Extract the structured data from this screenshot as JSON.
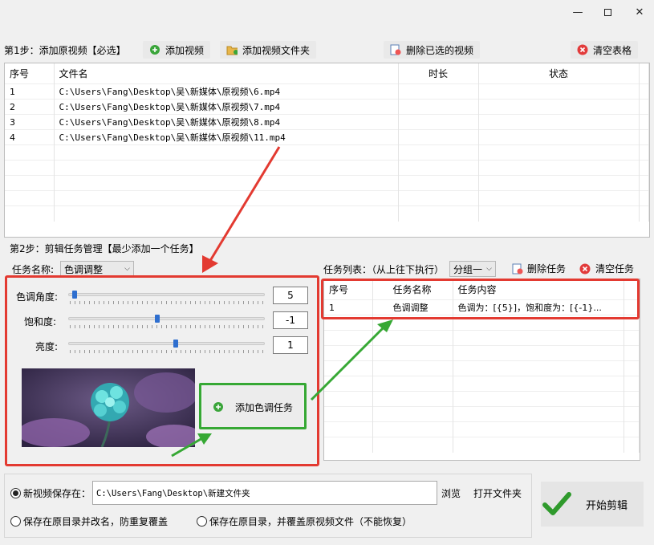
{
  "window": {
    "minimize_icon": "minimize-icon",
    "maximize_icon": "maximize-icon",
    "close_icon": "close-icon"
  },
  "step1": {
    "label": "第1步：添加原视频【必选】",
    "buttons": {
      "add_video": "添加视频",
      "add_folder": "添加视频文件夹",
      "delete_selected": "删除已选的视频",
      "clear_table": "清空表格"
    },
    "columns": [
      "序号",
      "文件名",
      "时长",
      "状态"
    ],
    "rows": [
      {
        "index": "1",
        "file": "C:\\Users\\Fang\\Desktop\\吴\\新媒体\\原视频\\6.mp4",
        "duration": "",
        "status": ""
      },
      {
        "index": "2",
        "file": "C:\\Users\\Fang\\Desktop\\吴\\新媒体\\原视频\\7.mp4",
        "duration": "",
        "status": ""
      },
      {
        "index": "3",
        "file": "C:\\Users\\Fang\\Desktop\\吴\\新媒体\\原视频\\8.mp4",
        "duration": "",
        "status": ""
      },
      {
        "index": "4",
        "file": "C:\\Users\\Fang\\Desktop\\吴\\新媒体\\原视频\\11.mp4",
        "duration": "",
        "status": ""
      }
    ]
  },
  "step2": {
    "label": "第2步：剪辑任务管理【最少添加一个任务】",
    "task_name_label": "任务名称:",
    "task_name_value": "色调调整",
    "sliders": [
      {
        "label": "色调角度:",
        "value": "5",
        "position": 0.02
      },
      {
        "label": "饱和度:",
        "value": "-1",
        "position": 0.45
      },
      {
        "label": "亮度:",
        "value": "1",
        "position": 0.55
      }
    ],
    "add_task_button": "添加色调任务",
    "task_list_label": "任务列表：（从上往下执行）",
    "group_select": "分组一",
    "delete_task": "删除任务",
    "clear_tasks": "清空任务",
    "task_columns": [
      "序号",
      "任务名称",
      "任务内容"
    ],
    "tasks": [
      {
        "index": "1",
        "name": "色调调整",
        "content": "色调为：[{5}]，饱和度为：[{-1}..."
      }
    ]
  },
  "output": {
    "save_to_label": "新视频保存在：",
    "save_path": "C:\\Users\\Fang\\Desktop\\新建文件夹",
    "browse": "浏览",
    "open_folder": "打开文件夹",
    "option_rename": "保存在原目录并改名，防重复覆盖",
    "option_overwrite": "保存在原目录，并覆盖原视频文件（不能恢复）",
    "start_button": "开始剪辑"
  },
  "colors": {
    "annotation_red": "#e33a31",
    "annotation_green": "#36a834",
    "slider_thumb": "#2f6fcf"
  }
}
